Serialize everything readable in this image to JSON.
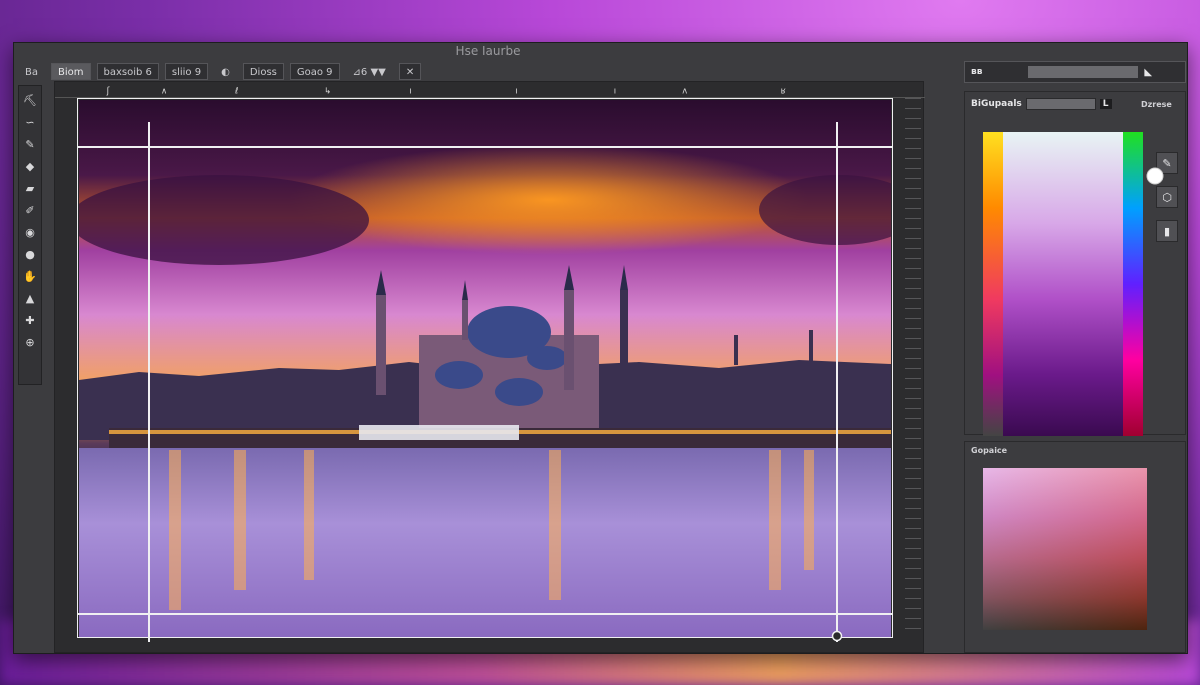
{
  "window": {
    "title": "Hse Iaurbe"
  },
  "options_bar": {
    "items": [
      {
        "label": "Ba",
        "selected": false,
        "plain": true
      },
      {
        "label": "Biom",
        "selected": true,
        "plain": false
      },
      {
        "label": "baxsoib 6",
        "selected": false,
        "plain": false
      },
      {
        "label": "sliio 9",
        "selected": false,
        "plain": false
      },
      {
        "label": "◐",
        "selected": false,
        "plain": true
      },
      {
        "label": "Dioss",
        "selected": false,
        "plain": false
      },
      {
        "label": "Goao 9",
        "selected": false,
        "plain": false
      },
      {
        "label": "⊿6 ▼▼",
        "selected": false,
        "plain": true
      },
      {
        "label": "✕",
        "selected": false,
        "plain": false
      }
    ]
  },
  "tools": [
    {
      "icon": "brush-icon",
      "glyph": "⛏"
    },
    {
      "icon": "lasso-icon",
      "glyph": "∽"
    },
    {
      "icon": "eyedropper-icon",
      "glyph": "✎"
    },
    {
      "icon": "paint-bucket-icon",
      "glyph": "◆"
    },
    {
      "icon": "eraser-icon",
      "glyph": "▰"
    },
    {
      "icon": "pen-icon",
      "glyph": "✐"
    },
    {
      "icon": "dodge-icon",
      "glyph": "◉"
    },
    {
      "icon": "burn-icon",
      "glyph": "●"
    },
    {
      "icon": "smudge-icon",
      "glyph": "✋"
    },
    {
      "icon": "stamp-icon",
      "glyph": "▲"
    },
    {
      "icon": "healing-icon",
      "glyph": "✚"
    },
    {
      "icon": "zoom-icon",
      "glyph": "⊕"
    }
  ],
  "ruler_ticks": [
    "ʃ",
    "∧",
    "ℓ",
    "↳",
    "ı",
    "ı",
    "ı",
    "ʌ",
    "ʁ"
  ],
  "right_panel": {
    "head_left": "ʙʙ",
    "color_label": "BiGupaals",
    "color_value": "L",
    "section_title": "Dzrese",
    "swatch_title": "Gopaice"
  },
  "colors": {
    "accent": "#b848d8",
    "panel_bg": "#3c3c3f",
    "guide": "#f0f0f2"
  }
}
